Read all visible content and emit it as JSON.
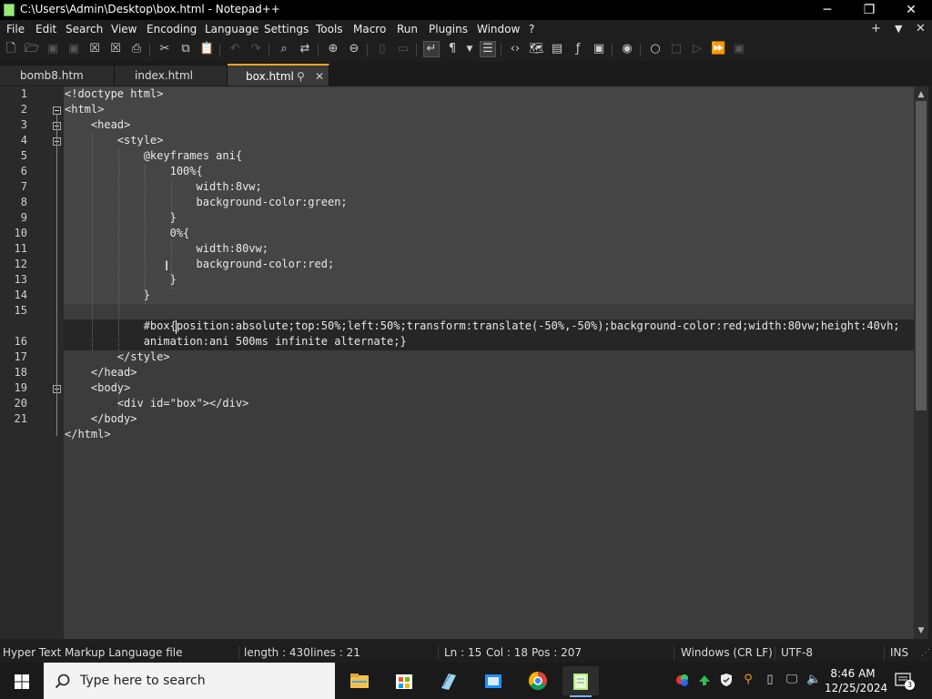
{
  "window": {
    "title": "C:\\Users\\Admin\\Desktop\\box.html - Notepad++",
    "minimize": "─",
    "maximize": "❐",
    "close": "✕"
  },
  "menu": {
    "items": [
      "File",
      "Edit",
      "Search",
      "View",
      "Encoding",
      "Language",
      "Settings",
      "Tools",
      "Macro",
      "Run",
      "Plugins",
      "Window",
      "?"
    ],
    "right_plus": "+",
    "right_down": "▼",
    "right_close": "✕"
  },
  "tabs": [
    {
      "label": "bomb8.htm"
    },
    {
      "label": "index.html"
    },
    {
      "label": "box.html",
      "pin": "⚲",
      "close": "✕"
    }
  ],
  "editor": {
    "lines": [
      "<!doctype html>",
      "<html>",
      "    <head>",
      "        <style>",
      "            @keyframes ani{",
      "                100%{",
      "                    width:8vw;",
      "                    background-color:green;",
      "                }",
      "                0%{",
      "                    width:80vw;",
      "                    background-color:red;",
      "                }",
      "            }",
      "",
      "            #box{position:absolute;top:50%;left:50%;transform:translate(-50%,-50%);background-color:red;width:80vw;height:40vh;",
      "            animation:ani 500ms infinite alternate;}",
      "        </style>",
      "    </head>",
      "    <body>",
      "        <div id=\"box\"></div>",
      "    </body>",
      "</html>"
    ],
    "line_numbers": [
      "1",
      "2",
      "3",
      "4",
      "5",
      "6",
      "7",
      "8",
      "9",
      "10",
      "11",
      "12",
      "13",
      "14",
      "15",
      "",
      "16",
      "17",
      "18",
      "19",
      "20",
      "21"
    ]
  },
  "status": {
    "file_type": "Hyper Text Markup Language file",
    "length": "length : 430",
    "lines": "lines : 21",
    "ln": "Ln : 15",
    "col": "Col : 18",
    "pos": "Pos : 207",
    "eol": "Windows (CR LF)",
    "encoding": "UTF-8",
    "mode": "INS"
  },
  "taskbar": {
    "search_placeholder": "Type here to search",
    "time": "8:46 AM",
    "date": "12/25/2024",
    "notification_count": "3"
  },
  "colors": {
    "accent_tab": "#f5a623",
    "editor_bg": "#3c3c3c",
    "titlebar_bg": "#000000"
  }
}
